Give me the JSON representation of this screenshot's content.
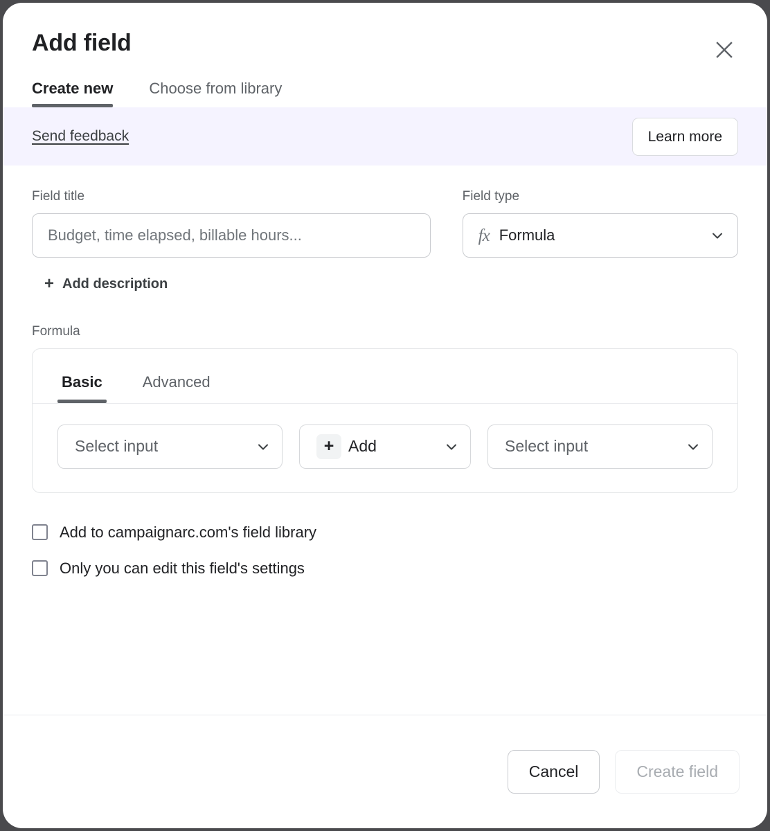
{
  "modal": {
    "title": "Add field",
    "close_icon": "close-icon"
  },
  "tabs": [
    {
      "label": "Create new",
      "active": true
    },
    {
      "label": "Choose from library",
      "active": false
    }
  ],
  "banner": {
    "feedback_label": "Send feedback",
    "learn_more_label": "Learn more",
    "background": "#f5f3ff"
  },
  "field_title": {
    "label": "Field title",
    "value": "",
    "placeholder": "Budget, time elapsed, billable hours..."
  },
  "field_type": {
    "label": "Field type",
    "icon": "fx-icon",
    "icon_glyph": "fx",
    "value": "Formula",
    "chevron": "chevron-down-icon"
  },
  "add_description": {
    "label": "Add description",
    "plus": "+"
  },
  "formula": {
    "label": "Formula",
    "tabs": [
      {
        "label": "Basic",
        "active": true
      },
      {
        "label": "Advanced",
        "active": false
      }
    ],
    "builder": {
      "left_input": "Select input",
      "operator": "Add",
      "operator_plus": "+",
      "right_input": "Select input"
    }
  },
  "checkboxes": [
    {
      "label": "Add to campaignarc.com's field library",
      "checked": false
    },
    {
      "label": "Only you can edit this field's settings",
      "checked": false
    }
  ],
  "footer": {
    "cancel_label": "Cancel",
    "create_label": "Create field",
    "create_disabled": true
  }
}
